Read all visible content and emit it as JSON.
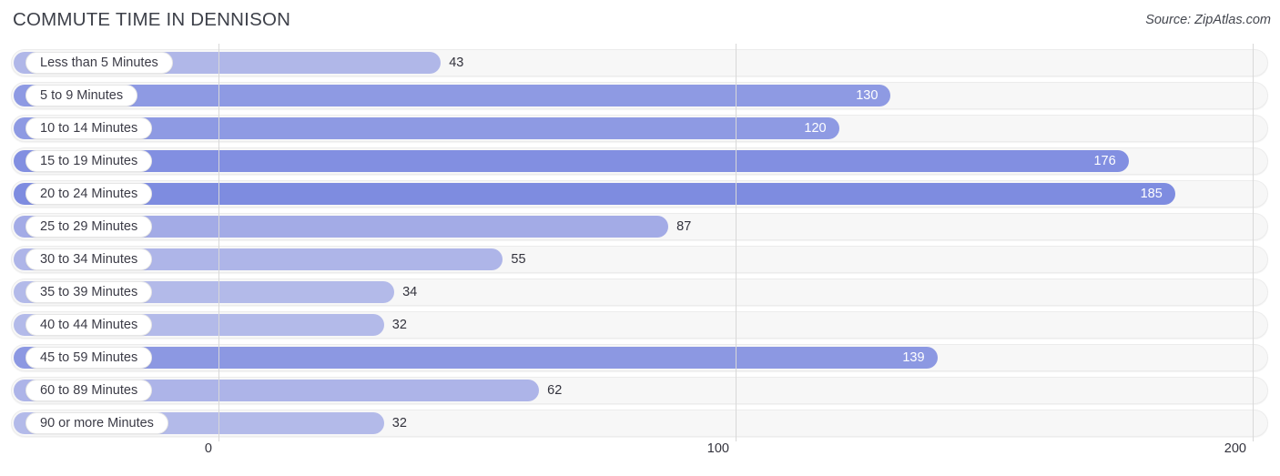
{
  "header": {
    "title": "COMMUTE TIME IN DENNISON",
    "source": "Source: ZipAtlas.com"
  },
  "colors": {
    "bar_light": "#b0b7e8",
    "bar_mid": "#8e9ae3",
    "bar_dark": "#7e8ce0",
    "track": "#f7f7f7",
    "grid": "#d8d8d8",
    "text": "#33333d"
  },
  "axis": {
    "min": 0,
    "max": 200,
    "ticks": [
      "0",
      "100",
      "200"
    ],
    "tick_values": [
      0,
      100,
      200
    ]
  },
  "chart_data": {
    "type": "bar",
    "orientation": "horizontal",
    "title": "COMMUTE TIME IN DENNISON",
    "source": "Source: ZipAtlas.com",
    "xlabel": "",
    "ylabel": "",
    "xlim": [
      0,
      200
    ],
    "grid": true,
    "legend": "none",
    "categories": [
      "Less than 5 Minutes",
      "5 to 9 Minutes",
      "10 to 14 Minutes",
      "15 to 19 Minutes",
      "20 to 24 Minutes",
      "25 to 29 Minutes",
      "30 to 34 Minutes",
      "35 to 39 Minutes",
      "40 to 44 Minutes",
      "45 to 59 Minutes",
      "60 to 89 Minutes",
      "90 or more Minutes"
    ],
    "values": [
      43,
      130,
      120,
      176,
      185,
      87,
      55,
      34,
      32,
      139,
      62,
      32
    ],
    "value_labels": [
      "43",
      "130",
      "120",
      "176",
      "185",
      "87",
      "55",
      "34",
      "32",
      "139",
      "62",
      "32"
    ]
  },
  "rows": [
    {
      "label": "Less than 5 Minutes",
      "value": 43,
      "value_label": "43",
      "inside": false,
      "color": "#b0b7e8"
    },
    {
      "label": "5 to 9 Minutes",
      "value": 130,
      "value_label": "130",
      "inside": true,
      "color": "#8e9ae3"
    },
    {
      "label": "10 to 14 Minutes",
      "value": 120,
      "value_label": "120",
      "inside": true,
      "color": "#8e9ae3"
    },
    {
      "label": "15 to 19 Minutes",
      "value": 176,
      "value_label": "176",
      "inside": true,
      "color": "#828fe1"
    },
    {
      "label": "20 to 24 Minutes",
      "value": 185,
      "value_label": "185",
      "inside": true,
      "color": "#7e8ce0"
    },
    {
      "label": "25 to 29 Minutes",
      "value": 87,
      "value_label": "87",
      "inside": false,
      "color": "#a3abe6"
    },
    {
      "label": "30 to 34 Minutes",
      "value": 55,
      "value_label": "55",
      "inside": false,
      "color": "#aeb5e8"
    },
    {
      "label": "35 to 39 Minutes",
      "value": 34,
      "value_label": "34",
      "inside": false,
      "color": "#b3bae9"
    },
    {
      "label": "40 to 44 Minutes",
      "value": 32,
      "value_label": "32",
      "inside": false,
      "color": "#b3bae9"
    },
    {
      "label": "45 to 59 Minutes",
      "value": 139,
      "value_label": "139",
      "inside": true,
      "color": "#8c98e2"
    },
    {
      "label": "60 to 89 Minutes",
      "value": 62,
      "value_label": "62",
      "inside": false,
      "color": "#adb4e8"
    },
    {
      "label": "90 or more Minutes",
      "value": 32,
      "value_label": "32",
      "inside": false,
      "color": "#b3bae9"
    }
  ]
}
